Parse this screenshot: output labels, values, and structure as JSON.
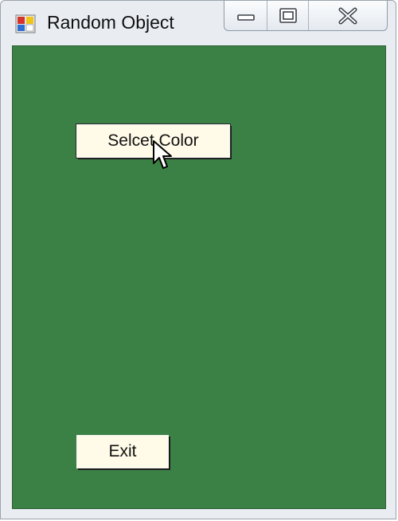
{
  "window": {
    "title": "Random Object"
  },
  "form": {
    "background_color": "#3b8145",
    "select_color_label": "Selcet Color",
    "exit_label": "Exit"
  },
  "icons": {
    "app": "form-app-icon",
    "minimize": "minimize-icon",
    "maximize": "maximize-icon",
    "close": "close-icon",
    "cursor": "mouse-pointer-icon"
  }
}
